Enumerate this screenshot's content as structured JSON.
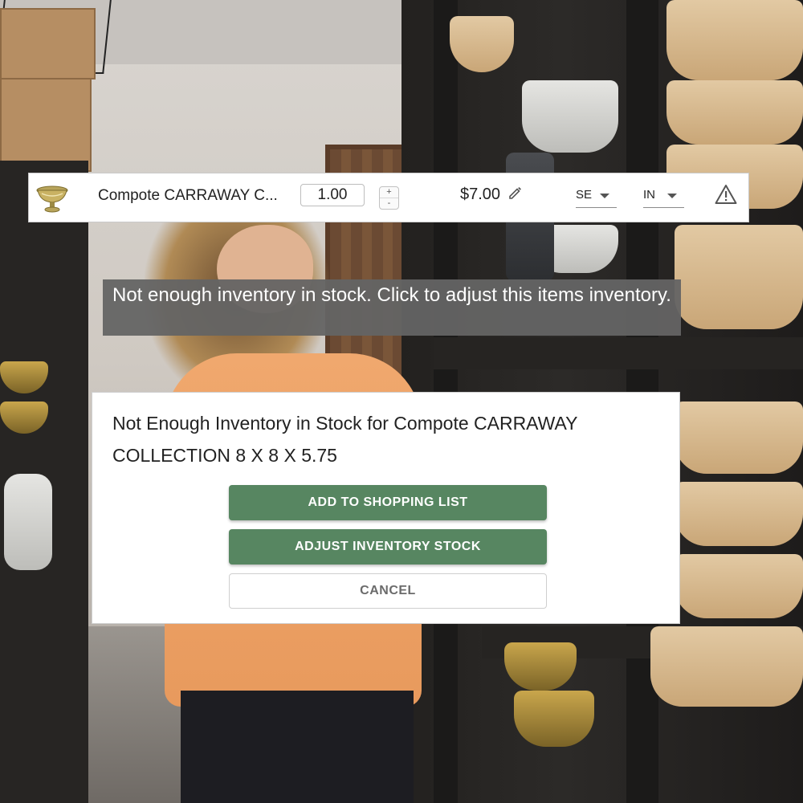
{
  "item_row": {
    "name": "Compote CARRAWAY C...",
    "quantity": "1.00",
    "stepper": {
      "up": "+",
      "down": "-"
    },
    "price": "$7.00",
    "unit_select_1": "SE",
    "unit_select_2": "IN",
    "icons": [
      "compote-thumbnail",
      "pencil-icon",
      "chevron-down-icon",
      "warning-icon"
    ]
  },
  "tooltip": {
    "text": "Not enough inventory in stock. Click to adjust this items inventory."
  },
  "dialog": {
    "title": "Not Enough Inventory in Stock for Compote CARRAWAY COLLECTION 8 X 8 X 5.75",
    "buttons": {
      "add_to_shopping_list": "ADD TO SHOPPING LIST",
      "adjust_inventory": "ADJUST INVENTORY STOCK",
      "cancel": "CANCEL"
    }
  },
  "colors": {
    "primary_button": "#578661",
    "tooltip_bg": "#646464"
  }
}
